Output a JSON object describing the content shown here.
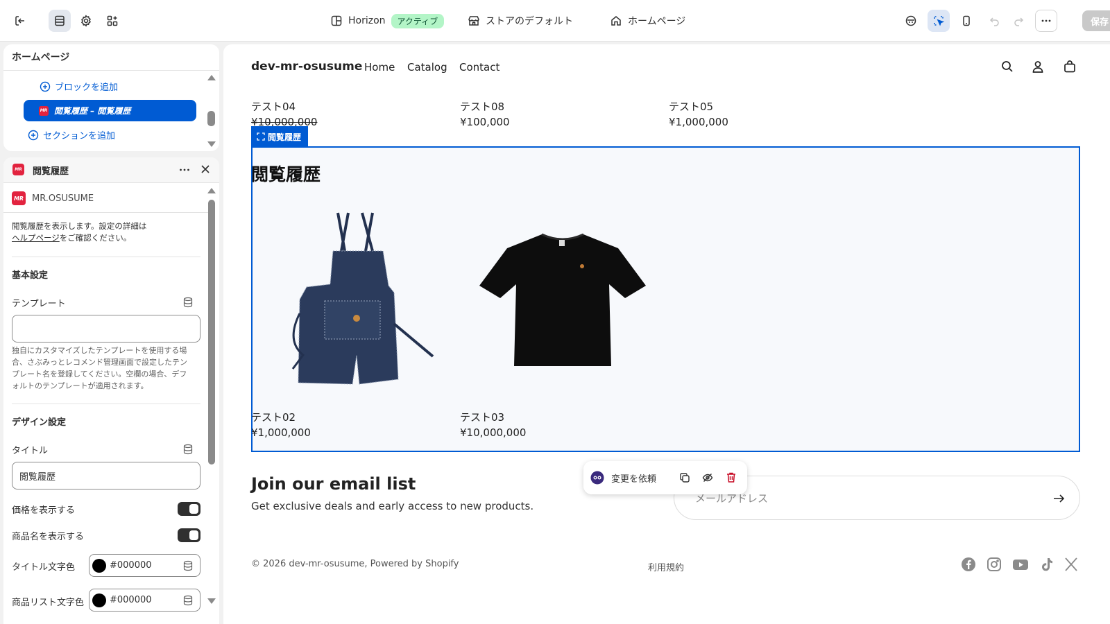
{
  "topbar": {
    "theme_name": "Horizon",
    "theme_status": "アクティブ",
    "store_default": "ストアのデフォルト",
    "page_select": "ホームページ",
    "save_label": "保存"
  },
  "sections_panel": {
    "title": "ホームページ",
    "add_block": "ブロックを追加",
    "selected_item": "閲覧履歴 – 閲覧履歴",
    "add_section": "セクションを追加"
  },
  "settings_panel": {
    "title": "閲覧履歴",
    "app_name": "MR.OSUSUME",
    "app_logo_text": "MR",
    "description_line1": "閲覧履歴を表示します。設定の詳細は",
    "help_link": "ヘルプページ",
    "description_line2": "をご確認ください。",
    "basic_settings": "基本設定",
    "template_label": "テンプレート",
    "template_value": "",
    "template_help": [
      "独自にカスタマイズしたテンプレートを使用する場",
      "合、さぶみっとレコメンド管理画面で設定したテン",
      "プレート名を登録してください。空欄の場合、デフ",
      "ォルトのテンプレートが適用されます。"
    ],
    "design_settings": "デザイン設定",
    "title_label": "タイトル",
    "title_value": "閲覧履歴",
    "show_price_label": "価格を表示する",
    "show_price": true,
    "show_name_label": "商品名を表示する",
    "show_name": true,
    "title_color_label": "タイトル文字色",
    "title_color": "#000000",
    "list_color_label": "商品リスト文字色",
    "list_color": "#000000"
  },
  "preview": {
    "brand": "dev-mr-osusume",
    "nav": [
      "Home",
      "Catalog",
      "Contact"
    ],
    "top_products": [
      {
        "name": "テスト04",
        "price": "¥10,000,000"
      },
      {
        "name": "テスト08",
        "price": "¥100,000"
      },
      {
        "name": "テスト05",
        "price": "¥1,000,000"
      }
    ],
    "selected_tag": "閲覧履歴",
    "section_title": "閲覧履歴",
    "history_products": [
      {
        "name": "テスト02",
        "price": "¥1,000,000",
        "image": "denim-apron"
      },
      {
        "name": "テスト03",
        "price": "¥10,000,000",
        "image": "black-tshirt"
      }
    ],
    "float_bar": {
      "request_label": "変更を依頼"
    },
    "email": {
      "title": "Join our email list",
      "subtitle": "Get exclusive deals and early access to new products.",
      "placeholder": "メールアドレス"
    },
    "footer": {
      "copyright": "© 2026 dev-mr-osusume, Powered by Shopify",
      "terms": "利用規約",
      "social": [
        "facebook-icon",
        "instagram-icon",
        "youtube-icon",
        "tiktok-icon",
        "x-icon"
      ]
    }
  },
  "colors": {
    "accent": "#005bd3",
    "active_badge": "#b3f5c7",
    "brand_red": "#e2233f"
  }
}
